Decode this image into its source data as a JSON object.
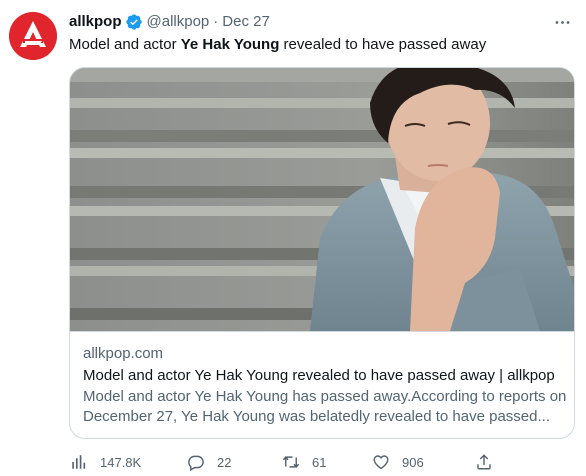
{
  "author": {
    "name": "allkpop",
    "handle": "@allkpop",
    "separator": "·",
    "date": "Dec 27"
  },
  "tweet": {
    "text_before": "Model and actor ",
    "text_bold": "Ye Hak Young",
    "text_after": " revealed to have passed away"
  },
  "card": {
    "domain": "allkpop.com",
    "title": "Model and actor Ye Hak Young revealed to have passed away | allkpop",
    "description": "Model and actor Ye Hak Young has passed away.According to reports on December 27, Ye Hak Young was belatedly revealed to have passed..."
  },
  "actions": {
    "views": "147.8K",
    "replies": "22",
    "retweets": "61",
    "likes": "906"
  },
  "colors": {
    "brand_red": "#e0262c",
    "verified_blue": "#1d9bf0",
    "secondary_text": "#536471",
    "border": "#cfd9de"
  },
  "icons": {
    "avatar": "allkpop-logo",
    "verified": "verified-badge-icon",
    "more": "more-icon",
    "views": "analytics-icon",
    "reply": "reply-icon",
    "retweet": "retweet-icon",
    "like": "like-icon",
    "share": "share-icon"
  }
}
